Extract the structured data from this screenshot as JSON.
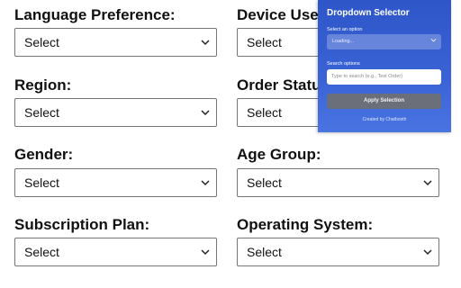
{
  "form": {
    "fields": [
      {
        "label": "Language Preference:",
        "value": "Select"
      },
      {
        "label": "Device Use",
        "value": "Select"
      },
      {
        "label": "Region:",
        "value": "Select"
      },
      {
        "label": "Order Statu",
        "value": "Select"
      },
      {
        "label": "Gender:",
        "value": "Select"
      },
      {
        "label": "Age Group:",
        "value": "Select"
      },
      {
        "label": "Subscription Plan:",
        "value": "Select"
      },
      {
        "label": "Operating System:",
        "value": "Select"
      }
    ]
  },
  "popup": {
    "title": "Dropdown Selector",
    "select_label": "Select an option",
    "select_value": "Loading...",
    "search_label": "Search options",
    "search_placeholder": "Type to search (e.g., Test Order)",
    "apply_button": "Apply Selection",
    "footer": "Created by Chatbooth"
  },
  "colors": {
    "popup_bg": "#3a63d6",
    "apply_button_bg": "#6b6f79"
  },
  "icons": [
    "chevron-down-icon"
  ]
}
